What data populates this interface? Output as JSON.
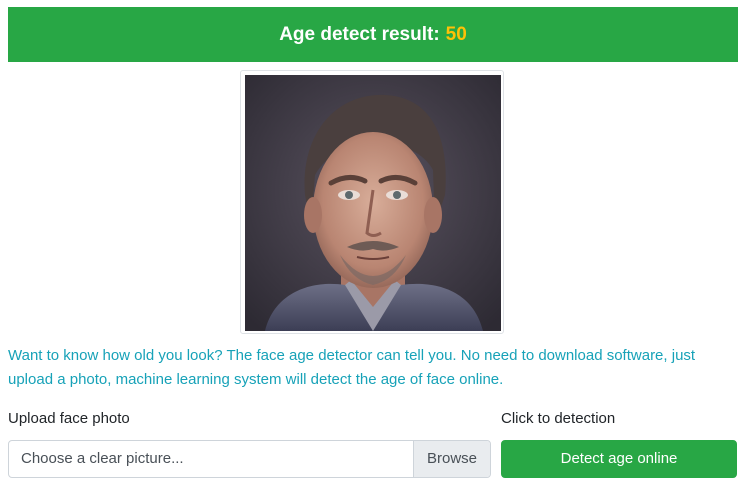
{
  "result": {
    "label": "Age detect result:",
    "age": "50"
  },
  "photo": {
    "icon": "face-photo"
  },
  "description": "Want to know how old you look? The face age detector can tell you. No need to download software, just upload a photo, machine learning system will detect the age of face online.",
  "upload": {
    "label": "Upload face photo",
    "placeholder": "Choose a clear picture...",
    "browse_label": "Browse"
  },
  "detect": {
    "label": "Click to detection",
    "button_label": "Detect age online"
  },
  "colors": {
    "accent_green": "#28a745",
    "age_yellow": "#ffc107",
    "description_teal": "#17a2b8"
  }
}
